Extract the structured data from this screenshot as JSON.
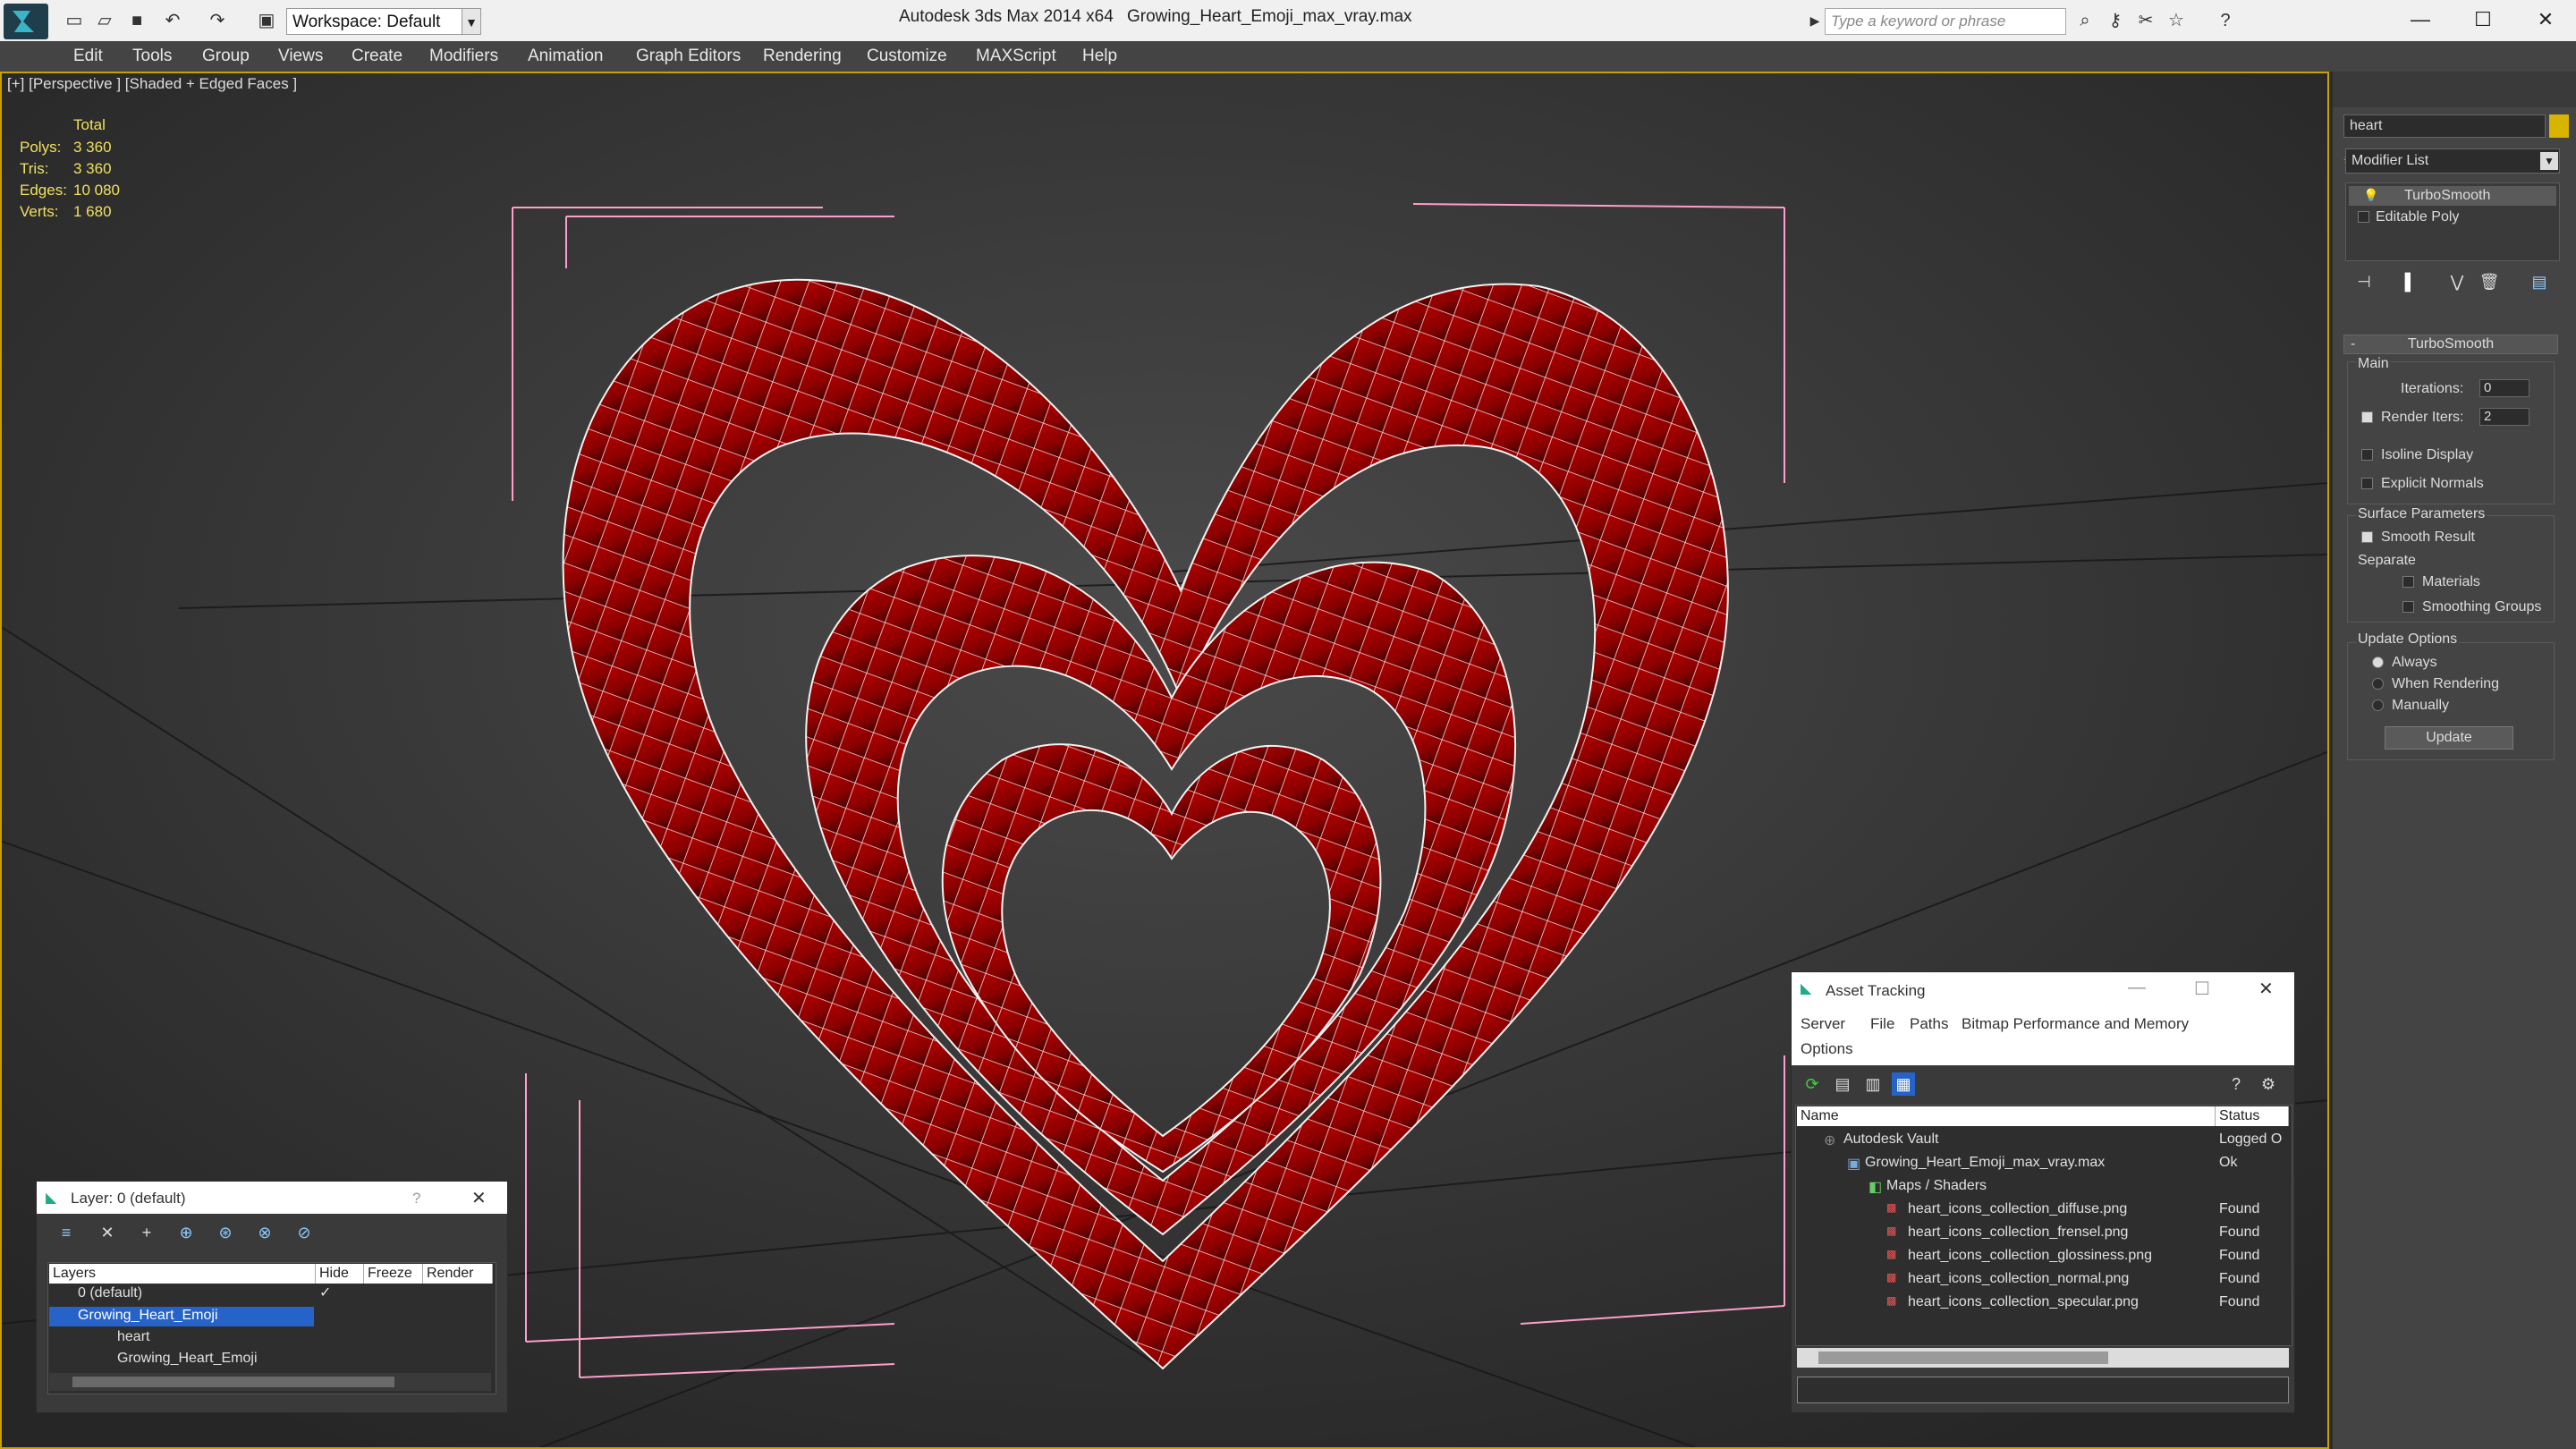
{
  "titlebar": {
    "app_title": "Autodesk 3ds Max  2014 x64",
    "file_name": "Growing_Heart_Emoji_max_vray.max",
    "workspace": "Workspace: Default",
    "search_placeholder": "Type a keyword or phrase"
  },
  "menu": [
    "Edit",
    "Tools",
    "Group",
    "Views",
    "Create",
    "Modifiers",
    "Animation",
    "Graph Editors",
    "Rendering",
    "Customize",
    "MAXScript",
    "Help"
  ],
  "viewport": {
    "label": "[+] [Perspective ] [Shaded + Edged Faces ]",
    "stats": {
      "header": "Total",
      "rows": [
        {
          "label": "Polys:",
          "value": "3 360"
        },
        {
          "label": "Tris:",
          "value": "3 360"
        },
        {
          "label": "Edges:",
          "value": "10 080"
        },
        {
          "label": "Verts:",
          "value": "1 680"
        }
      ]
    }
  },
  "command_panel": {
    "object_name": "heart",
    "modifier_list": "Modifier List",
    "stack": [
      "TurboSmooth",
      "Editable Poly"
    ],
    "rollout_title": "TurboSmooth",
    "main_label": "Main",
    "iterations_label": "Iterations:",
    "iterations_value": "0",
    "render_iters_label": "Render Iters:",
    "render_iters_value": "2",
    "isoline_label": "Isoline Display",
    "explicit_normals_label": "Explicit Normals",
    "surface_params_label": "Surface Parameters",
    "smooth_result_label": "Smooth Result",
    "separate_label": "Separate",
    "materials_label": "Materials",
    "smoothing_groups_label": "Smoothing Groups",
    "update_options_label": "Update Options",
    "always_label": "Always",
    "when_rendering_label": "When Rendering",
    "manually_label": "Manually",
    "update_button": "Update"
  },
  "layer_panel": {
    "title": "Layer: 0 (default)",
    "help": "?",
    "columns": [
      "Layers",
      "Hide",
      "Freeze",
      "Render"
    ],
    "rows": [
      "0 (default)",
      "Growing_Heart_Emoji",
      "heart",
      "Growing_Heart_Emoji"
    ]
  },
  "asset_panel": {
    "title": "Asset Tracking",
    "menu": [
      "Server",
      "File",
      "Paths",
      "Bitmap Performance and Memory",
      "Options"
    ],
    "columns": [
      "Name",
      "Status"
    ],
    "rows": [
      {
        "name": "Autodesk Vault",
        "status": "Logged O"
      },
      {
        "name": "Growing_Heart_Emoji_max_vray.max",
        "status": "Ok"
      },
      {
        "name": "Maps / Shaders",
        "status": ""
      },
      {
        "name": "heart_icons_collection_diffuse.png",
        "status": "Found"
      },
      {
        "name": "heart_icons_collection_frensel.png",
        "status": "Found"
      },
      {
        "name": "heart_icons_collection_glossiness.png",
        "status": "Found"
      },
      {
        "name": "heart_icons_collection_normal.png",
        "status": "Found"
      },
      {
        "name": "heart_icons_collection_specular.png",
        "status": "Found"
      }
    ]
  },
  "colors": {
    "heart": "#8a0000",
    "wire": "#ffffff",
    "selection": "#ff9ec8",
    "stats": "#f0e060",
    "viewport_border": "#c8a000"
  }
}
